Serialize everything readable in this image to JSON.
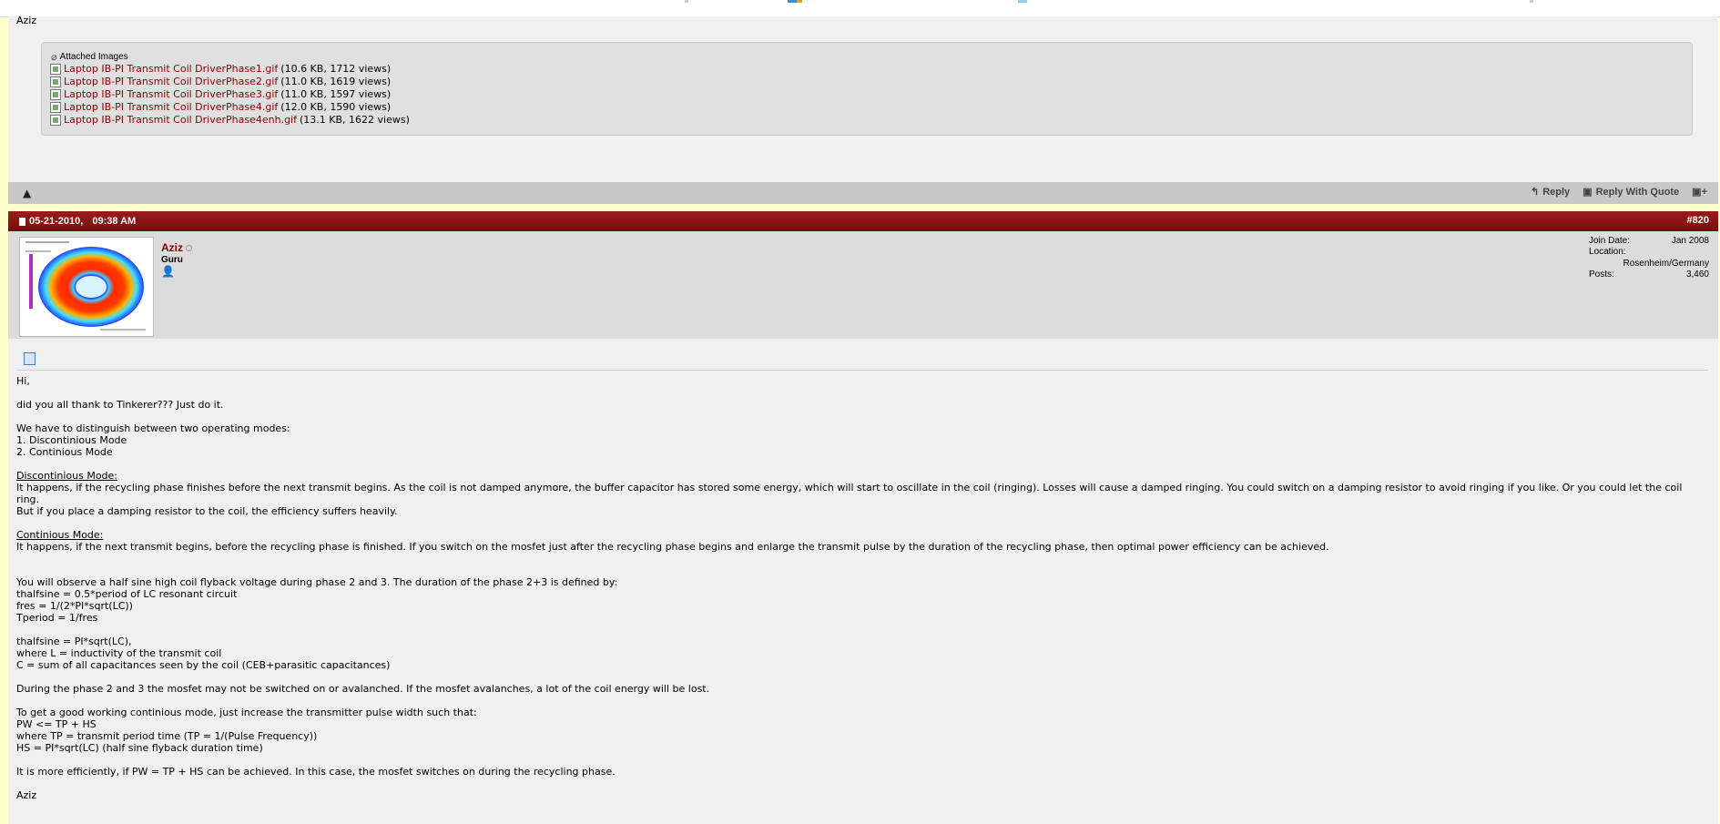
{
  "previous_post": {
    "signature": "Aziz",
    "attachments": {
      "header": "Attached Images",
      "items": [
        {
          "name": "Laptop IB-PI Transmit Coil DriverPhase1.gif",
          "meta": "(10.6 KB, 1712 views)"
        },
        {
          "name": "Laptop IB-PI Transmit Coil DriverPhase2.gif",
          "meta": "(11.0 KB, 1619 views)"
        },
        {
          "name": "Laptop IB-PI Transmit Coil DriverPhase3.gif",
          "meta": "(11.0 KB, 1597 views)"
        },
        {
          "name": "Laptop IB-PI Transmit Coil DriverPhase4.gif",
          "meta": "(12.0 KB, 1590 views)"
        },
        {
          "name": "Laptop IB-PI Transmit Coil DriverPhase4enh.gif",
          "meta": "(13.1 KB, 1622 views)"
        }
      ]
    },
    "actions": {
      "reply": "Reply",
      "reply_quote": "Reply With Quote"
    }
  },
  "post": {
    "date": "05-21-2010,",
    "time": "09:38 AM",
    "number": "#820",
    "user": {
      "name": "Aziz",
      "title": "Guru"
    },
    "info": {
      "join_label": "Join Date:",
      "join_value": "Jan 2008",
      "location_label": "Location:",
      "location_value": "Rosenheim/Germany",
      "posts_label": "Posts:",
      "posts_value": "3,460"
    },
    "body": {
      "l1": "Hi,",
      "l2": "did you all thank to Tinkerer??? Just do it.",
      "l3": "We have to distinguish between two operating modes:",
      "l4": "1. Discontinious Mode",
      "l5": "2. Continious Mode",
      "h1": "Discontinious Mode:",
      "l6": "It happens, if the recycling phase finishes before the next transmit begins. As the coil is not damped anymore, the buffer capacitor has stored some energy, which will start to oscillate in the coil (ringing). Losses will cause a damped ringing. You could switch on a damping resistor to avoid ringing if you like. Or you could let the coil ring.",
      "l7": "But if you place a damping resistor to the coil, the efficiency suffers heavily.",
      "h2": "Continious Mode:",
      "l8": "It happens, if the next transmit begins, before the recycling phase is finished. If you switch on the mosfet just after the recycling phase begins and enlarge the transmit pulse by the duration of the recycling phase, then optimal power efficiency can be achieved.",
      "l9": "You will observe a half sine high coil flyback voltage during phase 2 and 3. The duration of the phase 2+3 is defined by:",
      "l10": "thalfsine = 0.5*period of LC resonant circuit",
      "l11": "fres = 1/(2*PI*sqrt(LC))",
      "l12": "Tperiod = 1/fres",
      "l13": "thalfsine = PI*sqrt(LC),",
      "l14": "where L = inductivity of the transmit coil",
      "l15": "C = sum of all capacitances seen by the coil (CEB+parasitic capacitances)",
      "l16": "During the phase 2 and 3 the mosfet may not be switched on or avalanched. If the mosfet avalanches, a lot of the coil energy will be lost.",
      "l17": "To get a good working continious mode, just increase the transmitter pulse width such that:",
      "l18": "PW <= TP + HS",
      "l19": "where TP = transmit period time (TP = 1/(Pulse Frequency))",
      "l20": "HS = PI*sqrt(LC) (half sine flyback duration time)",
      "l21": "It is more efficiently, if PW = TP + HS can be achieved. In this case, the mosfet switches on during the recycling phase.",
      "l22": "Aziz"
    }
  }
}
